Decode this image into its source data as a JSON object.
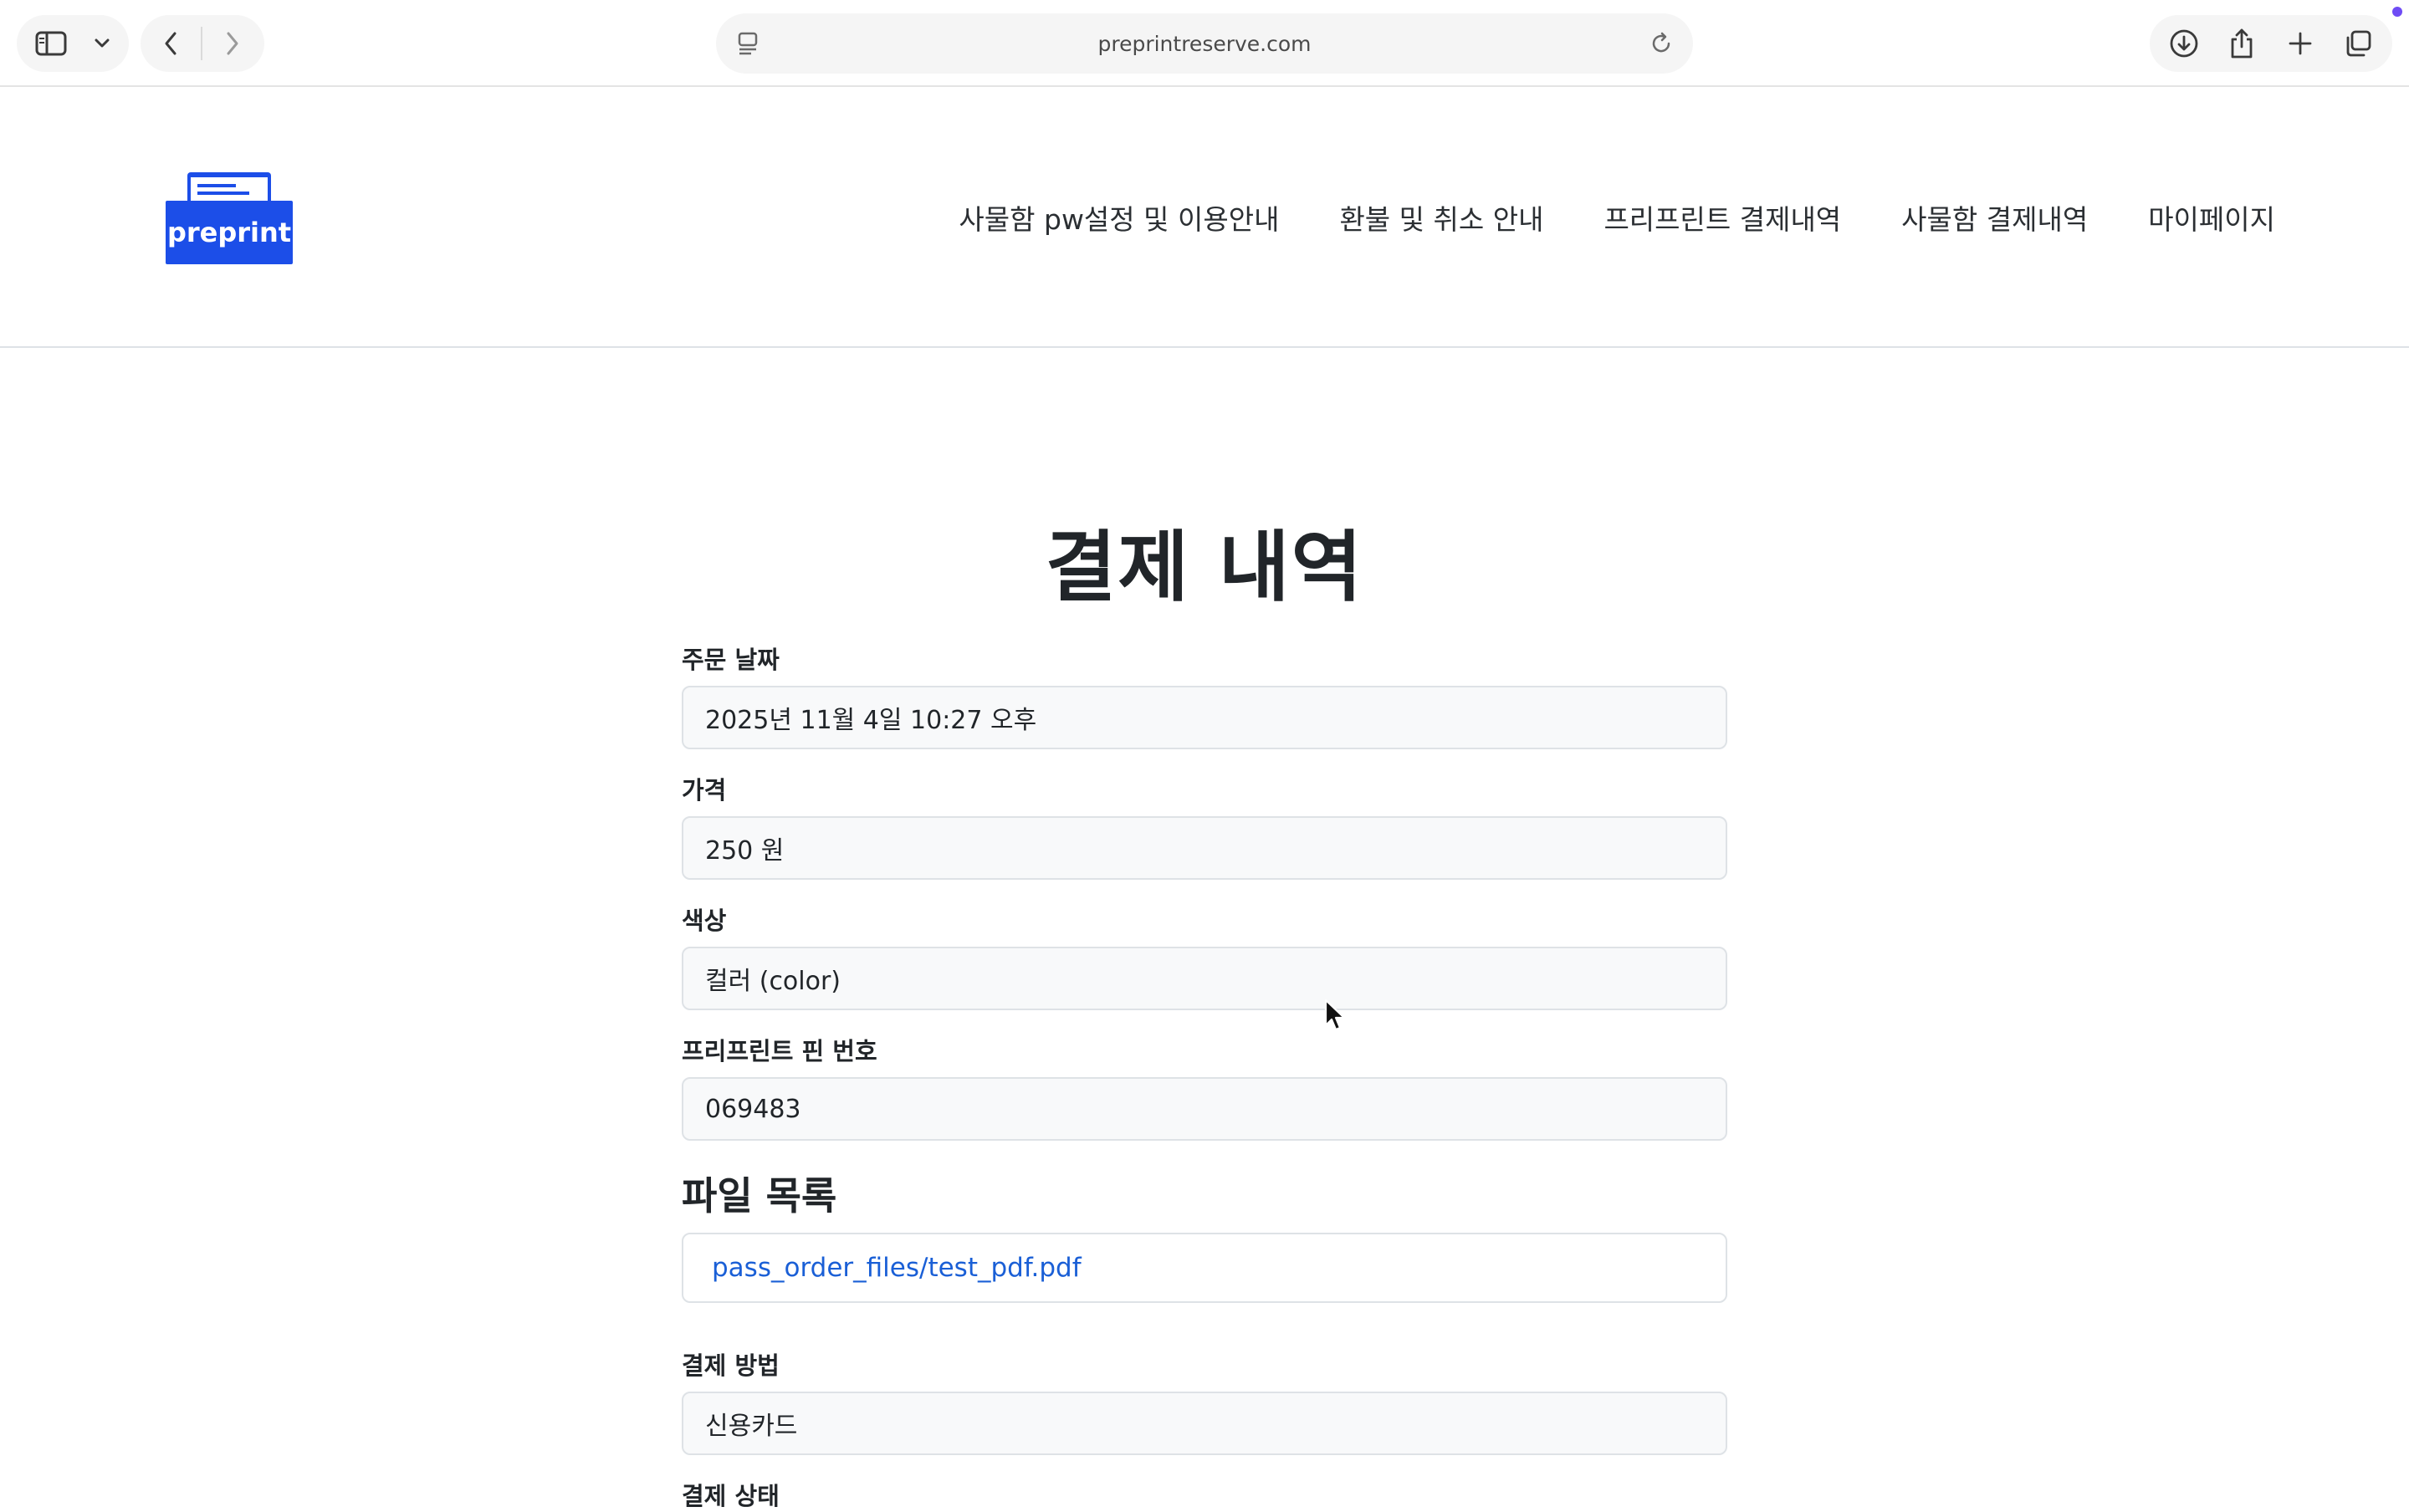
{
  "browser": {
    "address": "preprintreserve.com",
    "icons": {
      "sidebar": "sidebar-icon",
      "tab_menu": "chevron-down-icon",
      "back": "chevron-left-icon",
      "forward": "chevron-right-icon",
      "page_settings": "page-settings-icon",
      "reload": "reload-icon",
      "downloads": "download-icon",
      "share": "share-icon",
      "new_tab": "plus-icon",
      "tabs_overview": "tabs-overview-icon"
    }
  },
  "site": {
    "logo_text": "preprint",
    "brand_color": "#1c4ee8",
    "nav": [
      {
        "label": "사물함 pw설정 및 이용안내"
      },
      {
        "label": "환불 및 취소 안내"
      },
      {
        "label": "프리프린트 결제내역"
      },
      {
        "label": "사물함 결제내역"
      },
      {
        "label": "마이페이지"
      }
    ]
  },
  "order": {
    "title": "결제 내역",
    "fields": [
      {
        "label": "주문 날짜",
        "value": "2025년 11월 4일 10:27 오후"
      },
      {
        "label": "가격",
        "value": "250 원"
      },
      {
        "label": "색상",
        "value": "컬러 (color)"
      },
      {
        "label": "프리프린트 핀 번호",
        "value": "069483"
      }
    ],
    "files_title": "파일 목록",
    "files": [
      {
        "name": "pass_order_files/test_pdf.pdf"
      }
    ],
    "payment_method": {
      "label": "결제 방법",
      "value": "신용카드"
    },
    "payment_status": {
      "label": "결제 상태"
    }
  }
}
